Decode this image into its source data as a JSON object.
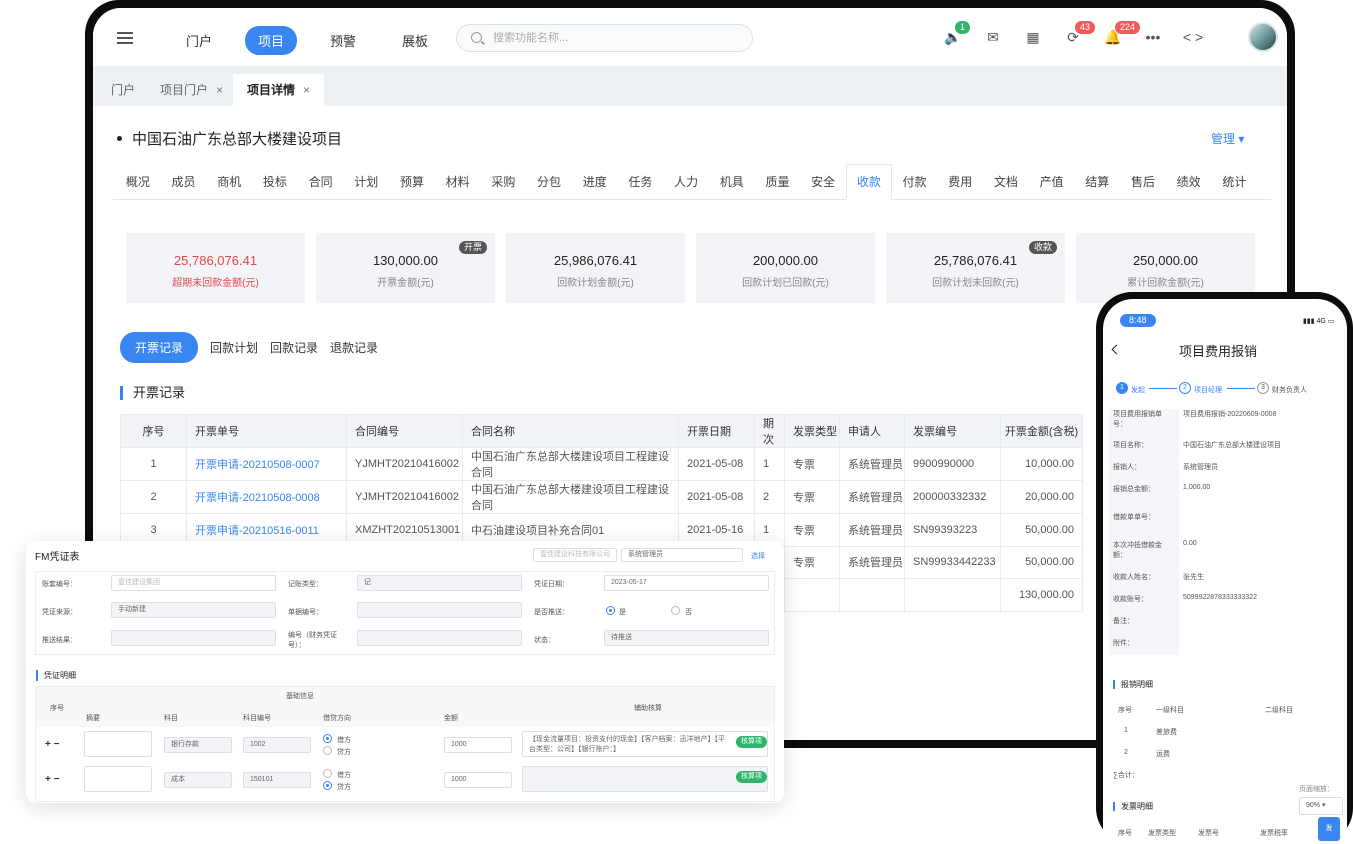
{
  "header": {
    "nav": [
      "门户",
      "项目",
      "预警",
      "展板"
    ],
    "search_placeholder": "搜索功能名称...",
    "badges": {
      "notice": "1",
      "sync": "43",
      "bell": "224"
    },
    "more": "•••",
    "code": "< >"
  },
  "tabs": [
    {
      "label": "门户"
    },
    {
      "label": "项目门户"
    },
    {
      "label": "项目详情"
    }
  ],
  "tab_close": "×",
  "project": {
    "title": "中国石油广东总部大楼建设项目",
    "manage": "管理 ▾"
  },
  "subtabs": [
    "概况",
    "成员",
    "商机",
    "投标",
    "合同",
    "计划",
    "预算",
    "材料",
    "采购",
    "分包",
    "进度",
    "任务",
    "人力",
    "机具",
    "质量",
    "安全",
    "收款",
    "付款",
    "费用",
    "文档",
    "产值",
    "结算",
    "售后",
    "绩效",
    "统计"
  ],
  "cards": [
    {
      "value": "25,786,076.41",
      "label": "超期未回款金额(元)",
      "tag": ""
    },
    {
      "value": "130,000.00",
      "label": "开票金额(元)",
      "tag": "开票"
    },
    {
      "value": "25,986,076.41",
      "label": "回款计划金额(元)",
      "tag": ""
    },
    {
      "value": "200,000.00",
      "label": "回款计划已回款(元)",
      "tag": ""
    },
    {
      "value": "25,786,076.41",
      "label": "回款计划未回款(元)",
      "tag": "收款"
    },
    {
      "value": "250,000.00",
      "label": "累计回款金额(元)",
      "tag": ""
    }
  ],
  "record_tabs": [
    "开票记录",
    "回款计划",
    "回款记录",
    "退款记录"
  ],
  "section_title": "开票记录",
  "table": {
    "headers": [
      "序号",
      "开票单号",
      "合同编号",
      "合同名称",
      "开票日期",
      "期次",
      "发票类型",
      "申请人",
      "发票编号",
      "开票金额(含税)"
    ],
    "rows": [
      [
        "1",
        "开票申请-20210508-0007",
        "YJMHT20210416002",
        "中国石油广东总部大楼建设项目工程建设合同",
        "2021-05-08",
        "1",
        "专票",
        "系统管理员",
        "9900990000",
        "10,000.00"
      ],
      [
        "2",
        "开票申请-20210508-0008",
        "YJMHT20210416002",
        "中国石油广东总部大楼建设项目工程建设合同",
        "2021-05-08",
        "2",
        "专票",
        "系统管理员",
        "200000332332",
        "20,000.00"
      ],
      [
        "3",
        "开票申请-20210516-0011",
        "XMZHT20210513001",
        "中石油建设项目补充合同01",
        "2021-05-16",
        "1",
        "专票",
        "系统管理员",
        "SN99393223",
        "50,000.00"
      ],
      [
        "",
        "",
        "",
        "",
        "",
        "",
        "专票",
        "系统管理员",
        "SN99933442233",
        "50,000.00"
      ],
      [
        "",
        "",
        "",
        "",
        "",
        "",
        "",
        "",
        "",
        "130,000.00"
      ]
    ]
  },
  "fm": {
    "title": "FM凭证表",
    "company": "壹佳建设科技有限公司",
    "user": "系统管理员",
    "choose": "选择",
    "fields": {
      "book_label": "账套编号：",
      "book_value": "壹佳建设集团",
      "type_label": "记账类型：",
      "type_value": "记",
      "date_label": "凭证日期：",
      "date_value": "2023-05-17",
      "source_label": "凭证来源：",
      "source_value": "手动新建",
      "doc_label": "单据编号：",
      "push_label": "是否推送：",
      "yes": "是",
      "no": "否",
      "result_label": "推送结果：",
      "num_label": "编号（财务凭证号）：",
      "status_label": "状态：",
      "status_value": "待推送"
    },
    "detail_title": "凭证明细",
    "cols": {
      "seq": "序号",
      "basic": "基础信息",
      "aux": "辅助核算",
      "summary": "摘要",
      "subject": "科目",
      "code": "科目编号",
      "dir": "借贷方向",
      "amount": "金额"
    },
    "rows": [
      {
        "ops": "+ −",
        "subject": "银行存款",
        "code": "1002",
        "debit": "借方",
        "credit": "贷方",
        "amount": "1000",
        "aux": "【现金流量项目：投资支付的现金】【客户档案：迅洋地产】【平台类型：公司】【银行账户：】",
        "btn": "核算项"
      },
      {
        "ops": "+ −",
        "subject": "成本",
        "code": "150101",
        "debit": "借方",
        "credit": "贷方",
        "amount": "1000",
        "aux": "",
        "btn": "核算项"
      }
    ]
  },
  "phone": {
    "time": "8:48",
    "signal": "4G",
    "title": "项目费用报销",
    "steps": [
      {
        "n": "1",
        "t": "发起"
      },
      {
        "n": "2",
        "t": "项目经理"
      },
      {
        "n": "3",
        "t": "财务负责人"
      }
    ],
    "fields": [
      {
        "l": "项目费用报销单号：",
        "v": "项目费用报销-20220609-0008"
      },
      {
        "l": "项目名称：",
        "v": "中国石油广东总部大楼建设项目"
      },
      {
        "l": "报销人：",
        "v": "系统管理员"
      },
      {
        "l": "报销总金额：",
        "v": "1,000.00"
      },
      {
        "l": "借款单单号：",
        "v": ""
      },
      {
        "l": "本次冲抵借款金额：",
        "v": "0.00"
      },
      {
        "l": "收款人姓名：",
        "v": "张先生"
      },
      {
        "l": "收款账号：",
        "v": "5099922878333333322"
      },
      {
        "l": "备注：",
        "v": ""
      },
      {
        "l": "附件：",
        "v": ""
      }
    ],
    "detail_title": "报销明细",
    "detail_cols": [
      "序号",
      "一级科目",
      "二级科目"
    ],
    "detail_rows": [
      [
        "1",
        "差旅费"
      ],
      [
        "2",
        "运费"
      ]
    ],
    "total": "∑合计：",
    "zoom_label": "页面缩放：",
    "zoom": "90%",
    "invoice_title": "发票明细",
    "invoice_cols": [
      "序号",
      "发票类型",
      "发票号",
      "发票税率",
      "发"
    ]
  },
  "colors": {
    "accent": "#3a86f0",
    "red": "#e04848",
    "badge_green": "#2fb56a",
    "badge_red": "#f05a5a"
  }
}
